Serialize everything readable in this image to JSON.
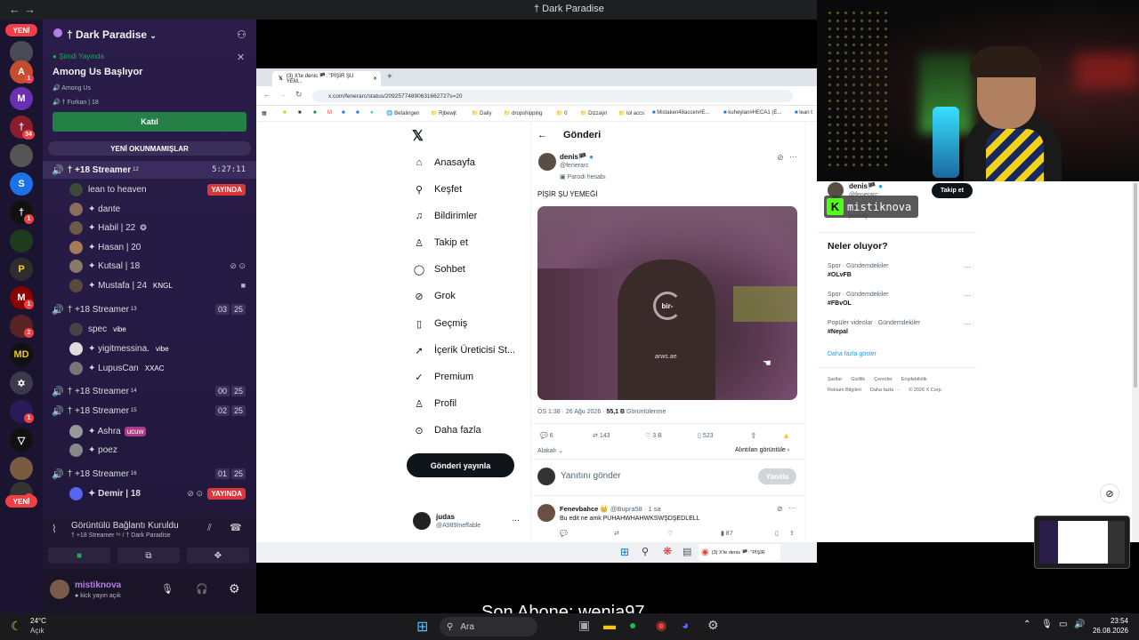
{
  "window": {
    "title": "† Dark Paradise",
    "back": "←",
    "forward": "→"
  },
  "guilds": {
    "new_top": "YENİ",
    "new_bottom": "YENİ",
    "badges": [
      "1",
      "34",
      "1",
      "1",
      "2",
      "1",
      "1"
    ]
  },
  "server": {
    "name": "† Dark Paradise",
    "event": {
      "status": "Şimdi Yayında",
      "title": "Among Us Başlıyor",
      "game": "Among Us",
      "channel": "† Furkan | 18",
      "join_label": "Katıl"
    },
    "unread_label": "YENİ OKUNMAMIŞLAR",
    "channels": [
      {
        "name": "† +18 Streamer",
        "sup": "12",
        "timer": "5:27:11",
        "users": [
          {
            "name": "lean to heaven",
            "live": "YAYINDA"
          },
          {
            "name": "✦ dante"
          },
          {
            "name": "✦ Habil | 22"
          },
          {
            "name": "✦ Hasan | 20"
          },
          {
            "name": "✦ Kutsal | 18"
          },
          {
            "name": "✦ Mustafa | 24",
            "tag": "KNGL"
          }
        ]
      },
      {
        "name": "† +18 Streamer",
        "sup": "13",
        "count": [
          "03",
          "25"
        ],
        "users": [
          {
            "name": "spec",
            "tag": "vibe"
          },
          {
            "name": "✦ yigitmessina.",
            "tag": "vibe"
          },
          {
            "name": "✦ LupusCan",
            "tag": "XXAC"
          }
        ]
      },
      {
        "name": "† +18 Streamer",
        "sup": "14",
        "count": [
          "00",
          "25"
        ]
      },
      {
        "name": "† +18 Streamer",
        "sup": "15",
        "count": [
          "02",
          "25"
        ],
        "users": [
          {
            "name": "✦ Ashra",
            "tag": "ucuw"
          },
          {
            "name": "✦ poez"
          }
        ]
      },
      {
        "name": "† +18 Streamer",
        "sup": "16",
        "count": [
          "01",
          "25"
        ],
        "users": [
          {
            "name": "✦ Demir | 18",
            "live": "YAYINDA"
          }
        ]
      }
    ]
  },
  "voice": {
    "status": "Görüntülü Bağlantı Kuruldu",
    "channel": "† +18 Streamer ¹⁶ / † Dark Paradise"
  },
  "user": {
    "name": "mistiknova",
    "status": "kick yayın açık"
  },
  "browser": {
    "tab_title": "(3) X'te denis 🏴: \"PİŞİR ŞU YEM...",
    "url": "x.com/fenerarc/status/20925774890631662727s=20",
    "bookmarks": [
      "Betalingen",
      "Rjbewjt",
      "Daily",
      "dropshipping",
      "0",
      "Dizzayn",
      "lol accs",
      "Mistaken48accen#E...",
      "kuheylan#HECA1 (E...",
      "lean t"
    ]
  },
  "x": {
    "nav": [
      "Anasayfa",
      "Keşfet",
      "Bildirimler",
      "Takip et",
      "Sohbet",
      "Grok",
      "Geçmiş",
      "İçerik Üreticisi St...",
      "Premium",
      "Profil",
      "Daha fazla"
    ],
    "post_button": "Gönderi yayınla",
    "account": {
      "name": "judas",
      "handle": "@A989Ineffable"
    },
    "header": "Gönderi",
    "tweet": {
      "author": "denis🏴",
      "handle": "@fenerarc",
      "parody": "Parodi hesabı",
      "text": "PİŞİR ŞU YEMEĞİ",
      "watermark": "arws.ae",
      "timestamp": "ÖS 1:38 · 26 Ağu 2026 ·",
      "views": "55,1 B",
      "views_label": "Görüntülenme",
      "stats": {
        "replies": "6",
        "retweets": "143",
        "likes": "3 B",
        "bookmarks": "523"
      },
      "related": "Alakalı",
      "quotes": "Alıntıları görüntüle"
    },
    "reply_placeholder": "Yanıtını gönder",
    "reply_button": "Yanıtla",
    "reply": {
      "author": "Fenevbahce 👑",
      "handle": "@Bupra58 · 1 sa",
      "text": "Bu edit ne amk PUHAHWHAHWKSWŞDŞEDLELL",
      "views": "87"
    },
    "side_profile": {
      "name": "denis🏴",
      "handle": "@fenerarc",
      "sub": "parody",
      "follow": "Takip et"
    },
    "trends_title": "Neler oluyor?",
    "trends": [
      {
        "category": "Spor · Gündemdekiler",
        "name": "#OLvFB"
      },
      {
        "category": "Spor · Gündemdekiler",
        "name": "#FBvOL"
      },
      {
        "category": "Popüler videolar · Gündemdekiler",
        "name": "#Nepal"
      }
    ],
    "more": "Daha fazla göster",
    "footer": [
      "Şartlar",
      "Gizlilik",
      "Çerezler",
      "Erişilebilirlik",
      "Reklam Bilgileri",
      "Daha fazla ···",
      "© 2026 X Corp."
    ]
  },
  "overlay": {
    "kick_name": "mistiknova",
    "last_sub": "Son Abone: wenja97"
  },
  "inner_taskbar": {
    "app": "(3) X'te denis 🏴: \"PİŞİR"
  },
  "taskbar": {
    "temp": "24°C",
    "weather": "Açık",
    "search": "Ara",
    "time": "23:54",
    "date": "26.08.2026"
  }
}
